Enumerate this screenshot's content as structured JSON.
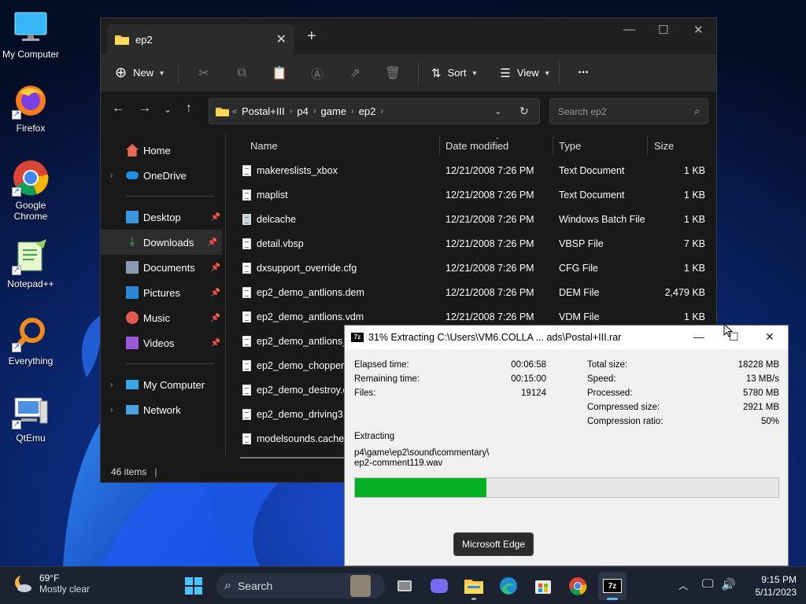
{
  "desktop": {
    "icons": [
      {
        "label": "My Computer",
        "icon": "monitor-icon"
      },
      {
        "label": "Firefox",
        "icon": "firefox-icon"
      },
      {
        "label": "Google Chrome",
        "icon": "chrome-icon"
      },
      {
        "label": "Notepad++",
        "icon": "notepadpp-icon"
      },
      {
        "label": "Everything",
        "icon": "everything-icon"
      },
      {
        "label": "QtEmu",
        "icon": "qtemu-icon"
      }
    ],
    "icon_labels": {
      "my_computer": "My Computer",
      "firefox": "Firefox",
      "chrome_line1": "Google",
      "chrome_line2": "Chrome",
      "notepadpp": "Notepad++",
      "everything": "Everything",
      "qtemu": "QtEmu"
    }
  },
  "explorer": {
    "tab_title": "ep2",
    "new_tab": "+",
    "toolbar": {
      "new_label": "New",
      "sort_label": "Sort",
      "view_label": "View",
      "more_label": "•••"
    },
    "address": {
      "overflow": "«",
      "crumbs": [
        "Postal+III",
        "p4",
        "game",
        "ep2"
      ]
    },
    "search_placeholder": "Search ep2",
    "sidebar": {
      "home": "Home",
      "onedrive": "OneDrive",
      "desktop": "Desktop",
      "downloads": "Downloads",
      "documents": "Documents",
      "pictures": "Pictures",
      "music": "Music",
      "videos": "Videos",
      "my_computer": "My Computer",
      "network": "Network"
    },
    "columns": {
      "name": "Name",
      "date": "Date modified",
      "type": "Type",
      "size": "Size"
    },
    "files": [
      {
        "name": "makereslists_xbox",
        "date": "12/21/2008 7:26 PM",
        "type": "Text Document",
        "size": "1 KB"
      },
      {
        "name": "maplist",
        "date": "12/21/2008 7:26 PM",
        "type": "Text Document",
        "size": "1 KB"
      },
      {
        "name": "delcache",
        "date": "12/21/2008 7:26 PM",
        "type": "Windows Batch File",
        "size": "1 KB"
      },
      {
        "name": "detail.vbsp",
        "date": "12/21/2008 7:26 PM",
        "type": "VBSP File",
        "size": "7 KB"
      },
      {
        "name": "dxsupport_override.cfg",
        "date": "12/21/2008 7:26 PM",
        "type": "CFG File",
        "size": "1 KB"
      },
      {
        "name": "ep2_demo_antlions.dem",
        "date": "12/21/2008 7:26 PM",
        "type": "DEM File",
        "size": "2,479 KB"
      },
      {
        "name": "ep2_demo_antlions.vdm",
        "date": "12/21/2008 7:26 PM",
        "type": "VDM File",
        "size": "1 KB"
      },
      {
        "name": "ep2_demo_antlions_s",
        "date": "",
        "type": "",
        "size": ""
      },
      {
        "name": "ep2_demo_chopper.d",
        "date": "",
        "type": "",
        "size": ""
      },
      {
        "name": "ep2_demo_destroy.de",
        "date": "",
        "type": "",
        "size": ""
      },
      {
        "name": "ep2_demo_driving3.d",
        "date": "",
        "type": "",
        "size": ""
      },
      {
        "name": "modelsounds.cache",
        "date": "",
        "type": "",
        "size": ""
      }
    ],
    "status": "46 items"
  },
  "zip": {
    "title": "31% Extracting C:\\Users\\VM6.COLLA ... ads\\Postal+III.rar",
    "icon_text": "7z",
    "left": {
      "elapsed_label": "Elapsed time:",
      "elapsed": "00:06:58",
      "remaining_label": "Remaining time:",
      "remaining": "00:15:00",
      "files_label": "Files:",
      "files": "19124"
    },
    "right": {
      "total_label": "Total size:",
      "total": "18228 MB",
      "speed_label": "Speed:",
      "speed": "13 MB/s",
      "processed_label": "Processed:",
      "processed": "5780 MB",
      "compressed_label": "Compressed size:",
      "compressed": "2921 MB",
      "ratio_label": "Compression ratio:",
      "ratio": "50%"
    },
    "extracting_label": "Extracting",
    "current_path_1": "p4\\game\\ep2\\sound\\commentary\\",
    "current_path_2": "ep2-comment119.wav",
    "progress_fraction": 0.31
  },
  "tooltip": "Microsoft Edge",
  "taskbar": {
    "weather_temp": "69°F",
    "weather_desc": "Mostly clear",
    "search_label": "Search",
    "time": "9:15 PM",
    "date": "5/11/2023"
  },
  "colors": {
    "progress_green": "#06b025",
    "explorer_bg": "#191919",
    "taskbar_bg": "#1c2230"
  }
}
